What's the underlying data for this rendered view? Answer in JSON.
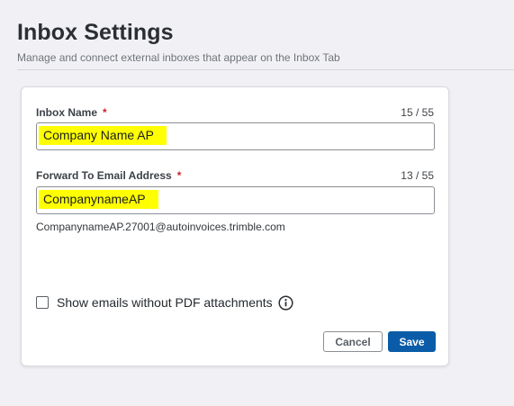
{
  "header": {
    "title": "Inbox Settings",
    "subtitle": "Manage and connect external inboxes that appear on the Inbox Tab"
  },
  "form": {
    "inbox_name": {
      "label": "Inbox Name",
      "required_marker": "*",
      "value": "Company Name AP",
      "char_count": "15 / 55"
    },
    "forward_email": {
      "label": "Forward To Email Address",
      "required_marker": "*",
      "value": "CompanynameAP",
      "char_count": "13 / 55",
      "helper": "CompanynameAP.27001@autoinvoices.trimble.com"
    },
    "show_without_pdf": {
      "label": "Show emails without PDF attachments",
      "checked": false,
      "info_icon": "info-circle-icon"
    },
    "buttons": {
      "cancel": "Cancel",
      "save": "Save"
    }
  },
  "colors": {
    "primary": "#0a5ca8",
    "required": "#c6262d",
    "highlight": "#ffff00",
    "background": "#f1f1f5"
  }
}
